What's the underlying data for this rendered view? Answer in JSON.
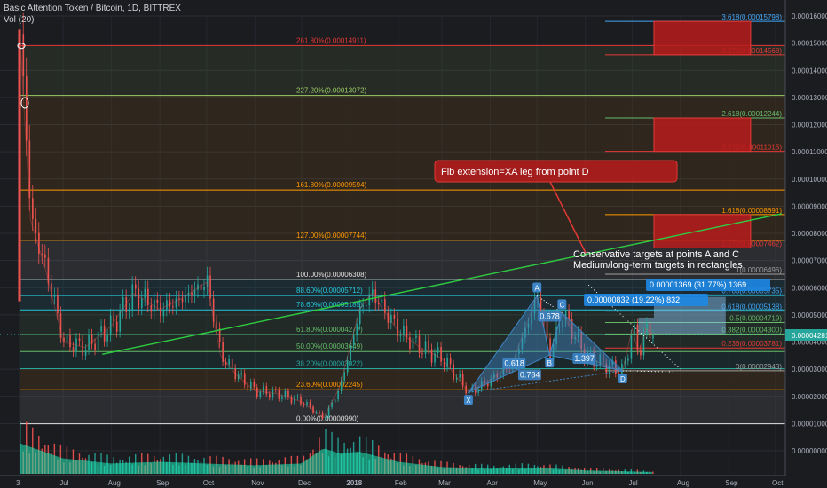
{
  "header": {
    "symbol": "Basic Attention Token / Bitcoin, 1D, BITTREX",
    "volume_indicator": "Vol (20)"
  },
  "colors": {
    "background": "#1b1c20",
    "up": "#26a69a",
    "down": "#ef5350",
    "trendline": "#2ecc40",
    "harmonic": "#3d85c6",
    "target_box": "#b71c1c",
    "last_price": "#26a69a"
  },
  "price_axis": {
    "ticks": [
      "0.00016000",
      "0.00015000",
      "0.00014000",
      "0.00013000",
      "0.00012000",
      "0.00011000",
      "0.00010000",
      "0.00009000",
      "0.00008000",
      "0.00007000",
      "0.00006000",
      "0.00005000",
      "0.00004000",
      "0.00003000",
      "0.00002000",
      "0.00001000",
      "0.00000000"
    ],
    "last_price_label": "0.00004281"
  },
  "time_axis": {
    "labels": [
      "3",
      "Jul",
      "Aug",
      "Sep",
      "Oct",
      "Nov",
      "Dec",
      "2018",
      "Feb",
      "Mar",
      "Apr",
      "May",
      "Jun",
      "Jul",
      "Aug",
      "Sep",
      "Oct"
    ]
  },
  "fib_retracement": [
    {
      "label": "261.80%(0.00014911)",
      "price": 0.00014911,
      "color": "#e53935"
    },
    {
      "label": "227.20%(0.00013072)",
      "price": 0.00013072,
      "color": "#9ccc65"
    },
    {
      "label": "161.80%(0.00009594)",
      "price": 9.594e-05,
      "color": "#ff9800"
    },
    {
      "label": "127.00%(0.00007744)",
      "price": 7.744e-05,
      "color": "#ff9800"
    },
    {
      "label": "100.00%(0.00006308)",
      "price": 6.308e-05,
      "color": "#e0e0e0"
    },
    {
      "label": "88.60%(0.00005712)",
      "price": 5.712e-05,
      "color": "#26c6da"
    },
    {
      "label": "78.60%(0.00005185)",
      "price": 5.185e-05,
      "color": "#26c6da"
    },
    {
      "label": "61.80%(0.00004277)",
      "price": 4.277e-05,
      "color": "#66bb6a"
    },
    {
      "label": "50.00%(0.00003649)",
      "price": 3.649e-05,
      "color": "#66bb6a"
    },
    {
      "label": "38.20%(0.00003022)",
      "price": 3.022e-05,
      "color": "#26a69a"
    },
    {
      "label": "23.60%(0.00002245)",
      "price": 2.245e-05,
      "color": "#ff9800"
    },
    {
      "label": "0.00%(0.00000990)",
      "price": 9.9e-06,
      "color": "#e0e0e0"
    }
  ],
  "fib_extension": [
    {
      "label": "3.618(0.00015798)",
      "price": 0.00015798,
      "color": "#42a5f5"
    },
    {
      "label": "3.272(0.00014568)",
      "price": 0.00014568,
      "color": "#e53935"
    },
    {
      "label": "2.618(0.00012244)",
      "price": 0.00012244,
      "color": "#66bb6a"
    },
    {
      "label": "2.272(0.00011015)",
      "price": 0.00011015,
      "color": "#e53935"
    },
    {
      "label": "1.618(0.00008691)",
      "price": 8.691e-05,
      "color": "#ff9800"
    },
    {
      "label": "1.272(0.00007462)",
      "price": 7.462e-05,
      "color": "#e53935"
    },
    {
      "label": "1(0.00006496)",
      "price": 6.496e-05,
      "color": "#9e9e9e"
    },
    {
      "label": "0.786(0.00005735)",
      "price": 5.735e-05,
      "color": "#42a5f5"
    },
    {
      "label": "0.618(0.00005138)",
      "price": 5.138e-05,
      "color": "#42a5f5"
    },
    {
      "label": "0.5(0.00004719)",
      "price": 4.719e-05,
      "color": "#66bb6a"
    },
    {
      "label": "0.382(0.00004300)",
      "price": 4.3e-05,
      "color": "#66bb6a"
    },
    {
      "label": "0.236(0.00003781)",
      "price": 3.781e-05,
      "color": "#e53935"
    },
    {
      "label": "0(0.00002943)",
      "price": 2.943e-05,
      "color": "#9e9e9e"
    }
  ],
  "pattern_points": {
    "X": {
      "label": "X",
      "date": "2018-03-18",
      "price": 2.15e-05
    },
    "A": {
      "label": "A",
      "date": "2018-05-01",
      "price": 5.7e-05
    },
    "B": {
      "label": "B",
      "date": "2018-05-09",
      "price": 3.52e-05
    },
    "C": {
      "label": "C",
      "date": "2018-05-17",
      "price": 5.08e-05
    },
    "D": {
      "label": "D",
      "date": "2018-06-25",
      "price": 2.94e-05
    }
  },
  "pattern_ratios": [
    "0.678",
    "0.618",
    "0.784",
    "1.397"
  ],
  "measure_labels": [
    "0.00001369 (31.77%) 1369",
    "0.00000832 (19.22%) 832"
  ],
  "annotations": {
    "callout": "Fib extension=XA leg from point D",
    "note_line1": "Conservative targets at points A and C",
    "note_line2": "Medium/long-term targets in rectangles"
  },
  "chart_data": {
    "type": "line",
    "title": "Basic Attention Token / Bitcoin, 1D, BITTREX",
    "xlabel": "",
    "ylabel": "",
    "ylim": [
      -7.5e-06,
      0.000162
    ],
    "series": [
      {
        "name": "",
        "x": [
          "2017-06-03",
          "2017-06-10",
          "2017-06-20",
          "2017-07-01",
          "2017-07-15",
          "2017-08-01",
          "2017-08-15",
          "2017-09-01",
          "2017-09-15",
          "2017-10-01",
          "2017-10-10",
          "2017-10-20",
          "2017-11-01",
          "2017-11-15",
          "2017-12-01",
          "2017-12-15",
          "2017-12-25",
          "2018-01-01",
          "2018-01-07",
          "2018-01-15",
          "2018-02-01",
          "2018-02-15",
          "2018-03-01",
          "2018-03-18",
          "2018-04-01",
          "2018-04-15",
          "2018-05-01",
          "2018-05-09",
          "2018-05-17",
          "2018-06-01",
          "2018-06-15",
          "2018-06-25",
          "2018-07-01",
          "2018-07-05",
          "2018-07-10",
          "2018-07-15"
        ],
        "values": [
          0.000155,
          8.5e-05,
          6.6e-05,
          4e-05,
          3.8e-05,
          4.6e-05,
          5.8e-05,
          5.2e-05,
          5.6e-05,
          6.2e-05,
          3.5e-05,
          2.8e-05,
          2.2e-05,
          2.1e-05,
          1.8e-05,
          1.2e-05,
          2.3e-05,
          3.8e-05,
          5.2e-05,
          5.8e-05,
          4.4e-05,
          3.8e-05,
          3.4e-05,
          2.15e-05,
          2.6e-05,
          3.2e-05,
          5.7e-05,
          3.52e-05,
          5.08e-05,
          3.5e-05,
          3.1e-05,
          2.94e-05,
          4.5e-05,
          3.6e-05,
          4.49e-05,
          4.28e-05
        ]
      }
    ],
    "volume": {
      "x": [
        "2017-06-03",
        "2017-07-01",
        "2017-08-01",
        "2017-09-01",
        "2017-10-01",
        "2017-11-01",
        "2017-12-01",
        "2017-12-15",
        "2017-12-25",
        "2018-01-07",
        "2018-02-01",
        "2018-03-01",
        "2018-04-01",
        "2018-05-01",
        "2018-06-01",
        "2018-07-01",
        "2018-07-15"
      ],
      "values": [
        0.9,
        0.45,
        0.3,
        0.35,
        0.3,
        0.25,
        0.3,
        0.75,
        0.6,
        0.65,
        0.35,
        0.2,
        0.15,
        0.18,
        0.1,
        0.07,
        0.05
      ]
    },
    "trendline": {
      "x": [
        "2017-07-01",
        "2018-10-05"
      ],
      "values": [
        3.55e-05,
        8.72e-05
      ]
    },
    "target_boxes": [
      {
        "x0": "2018-07-15",
        "x1": "2018-09-15",
        "low": 0.00014568,
        "high": 0.00015798
      },
      {
        "x0": "2018-07-15",
        "x1": "2018-09-15",
        "low": 0.00011015,
        "high": 0.00012244
      },
      {
        "x0": "2018-07-15",
        "x1": "2018-09-15",
        "low": 7.462e-05,
        "high": 8.691e-05
      }
    ],
    "target_zones": [
      {
        "x0": "2018-07-15",
        "x1": "2018-08-30",
        "low": 4.3e-05,
        "high": 5.66e-05
      },
      {
        "x0": "2018-07-05",
        "x1": "2018-07-15",
        "low": 4.3e-05,
        "high": 4.9e-05
      }
    ],
    "grid": true,
    "legend": "none"
  }
}
